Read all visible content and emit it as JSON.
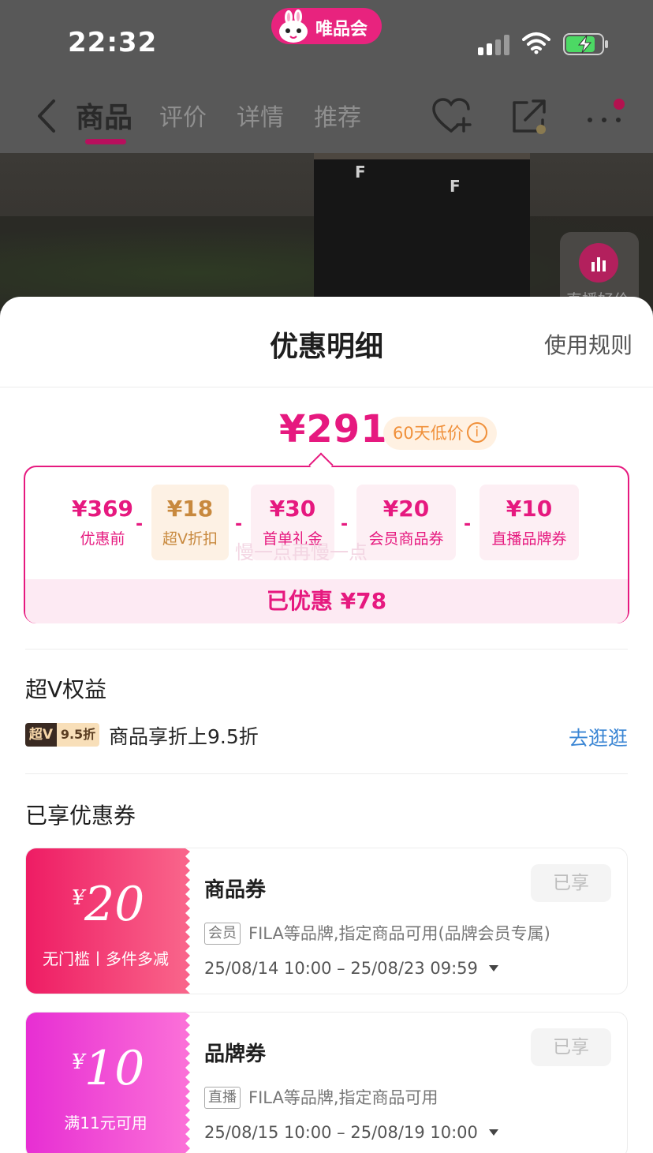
{
  "status_bar": {
    "time": "22:32",
    "app_pill": "唯品会"
  },
  "nav": {
    "tabs": [
      {
        "label": "商品",
        "active": true
      },
      {
        "label": "评价",
        "active": false
      },
      {
        "label": "详情",
        "active": false
      },
      {
        "label": "推荐",
        "active": false
      }
    ],
    "icons": [
      "back-icon",
      "favorite-add-icon",
      "share-icon",
      "more-icon"
    ]
  },
  "product": {
    "brand_mark": "F",
    "live_widget_label": "直播好价"
  },
  "sheet": {
    "title": "优惠明细",
    "rules_link": "使用规则",
    "final_price": "¥291",
    "low_price_badge": "60天低价",
    "breakdown": [
      {
        "amount": "¥369",
        "label": "优惠前"
      },
      {
        "amount": "¥18",
        "label": "超V折扣"
      },
      {
        "amount": "¥30",
        "label": "首单礼金"
      },
      {
        "amount": "¥20",
        "label": "会员商品券"
      },
      {
        "amount": "¥10",
        "label": "直播品牌券"
      }
    ],
    "operator": "-",
    "total_saved": "已优惠 ¥78",
    "watermark": "慢一点再慢一点"
  },
  "super_v": {
    "section_title": "超V权益",
    "badge_left": "超V",
    "badge_right": "9.5折",
    "description": "商品享折上9.5折",
    "link": "去逛逛"
  },
  "coupons": {
    "section_title": "已享优惠券",
    "items": [
      {
        "yen": "¥",
        "value": "20",
        "condition": "无门槛丨多件多减",
        "name": "商品券",
        "status": "已享",
        "tag": "会员",
        "description": "FILA等品牌,指定商品可用(品牌会员专属)",
        "validity": "25/08/14 10:00 – 25/08/23 09:59"
      },
      {
        "yen": "¥",
        "value": "10",
        "condition": "满11元可用",
        "name": "品牌券",
        "status": "已享",
        "tag": "直播",
        "description": "FILA等品牌,指定商品可用",
        "validity": "25/08/15 10:00 – 25/08/19 10:00"
      }
    ]
  },
  "colors": {
    "brand_pink": "#e6197f",
    "vip_gold": "#c8893e",
    "link_blue": "#3b86d4",
    "coupon1_gradient": [
      "#ee1c64",
      "#f9648a"
    ],
    "coupon2_gradient": [
      "#e72ed3",
      "#fb6fd8"
    ]
  }
}
